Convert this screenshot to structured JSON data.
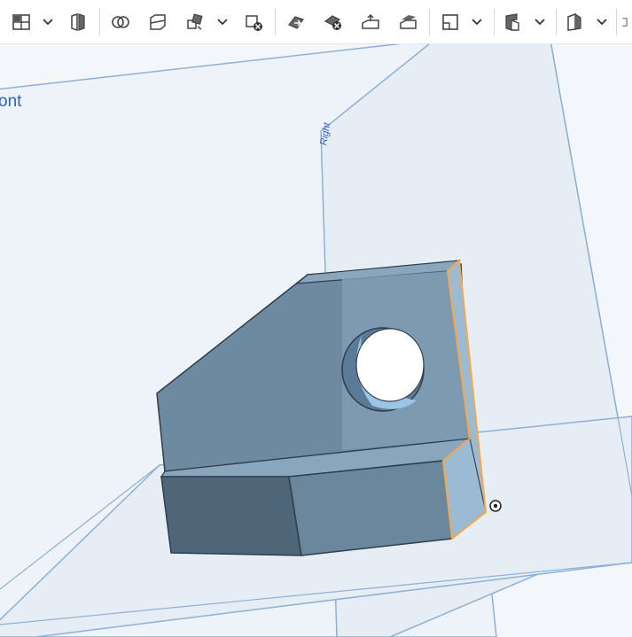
{
  "toolbar": {
    "tools": [
      {
        "id": "view-layout",
        "icon": "panels-icon",
        "has_menu": true
      },
      {
        "id": "section-view",
        "icon": "section-icon",
        "has_menu": false
      },
      {
        "id": "boolean",
        "icon": "boolean-icon",
        "has_menu": false
      },
      {
        "id": "split",
        "icon": "split-icon",
        "has_menu": false
      },
      {
        "id": "transform",
        "icon": "transform-icon",
        "has_menu": true
      },
      {
        "id": "delete-part",
        "icon": "delete-part-icon",
        "has_menu": false
      },
      {
        "id": "move-face",
        "icon": "move-face-icon",
        "has_menu": false
      },
      {
        "id": "delete-face",
        "icon": "delete-face-icon",
        "has_menu": false
      },
      {
        "id": "offset-surface",
        "icon": "offset-surface-icon",
        "has_menu": false
      },
      {
        "id": "replace-face",
        "icon": "replace-face-icon",
        "has_menu": false
      },
      {
        "id": "plane",
        "icon": "plane-icon",
        "has_menu": true
      },
      {
        "id": "sheet-metal",
        "icon": "sheet-metal-icon",
        "has_menu": true
      },
      {
        "id": "frame",
        "icon": "frame-icon",
        "has_menu": true
      }
    ]
  },
  "planes": {
    "front_label": "ont",
    "right_label": "Right"
  },
  "colors": {
    "part_face_light": "#7f9bb1",
    "part_face_mid": "#6a879e",
    "part_face_dark": "#4f6678",
    "part_face_side": "#9bbad3",
    "selected_edge": "#f6a848",
    "plane_stroke": "#8fb0d6",
    "plane_label": "#2f63c0"
  }
}
